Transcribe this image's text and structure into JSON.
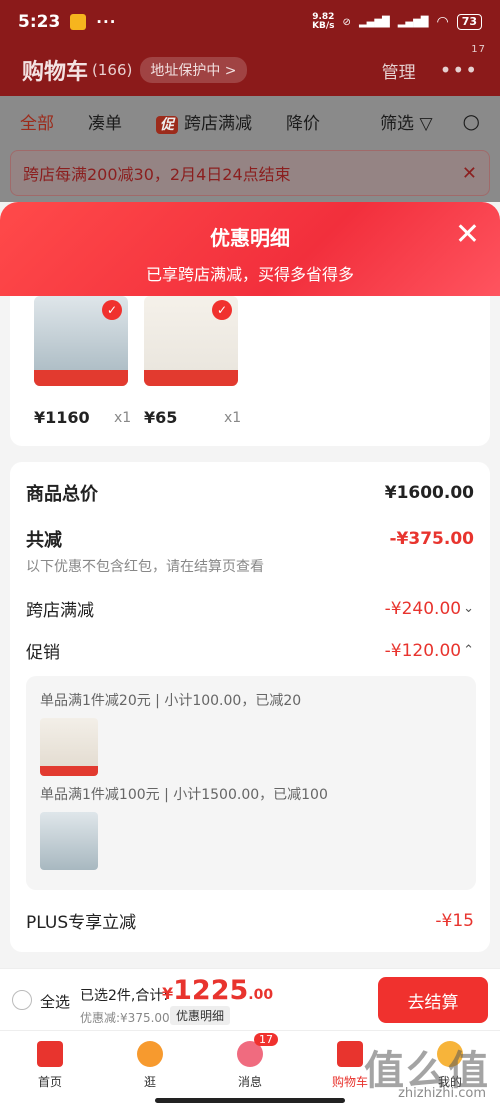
{
  "status": {
    "time": "5:23",
    "speed_top": "9.82",
    "speed_bottom": "KB/s",
    "battery": "73"
  },
  "header": {
    "title": "购物车",
    "count": "(166)",
    "address": "地址保护中 >",
    "manage": "管理",
    "more_badge": "17"
  },
  "tabs": [
    "全部",
    "凑单",
    "跨店满减",
    "降价",
    "筛选"
  ],
  "promo_tag": "促",
  "promo_bar": {
    "text": "跨店每满200减30，2月4日24点结束"
  },
  "sheet": {
    "title": "优惠明细",
    "subtitle": "已享跨店满减，买得多省得多"
  },
  "products": [
    {
      "price": "¥1160",
      "qty": "x1"
    },
    {
      "price": "¥65",
      "qty": "x1"
    }
  ],
  "summary": {
    "total_label": "商品总价",
    "total_value": "¥1600.00",
    "reduce_label": "共减",
    "reduce_value": "-¥375.00",
    "note": "以下优惠不包含红包，请在结算页查看",
    "cross_label": "跨店满减",
    "cross_value": "-¥240.00",
    "promo_label": "促销",
    "promo_value": "-¥120.00",
    "promo_line1": "单品满1件减20元 | 小计100.00，已减20",
    "promo_line2": "单品满1件减100元 | 小计1500.00，已减100",
    "plus_label": "PLUS专享立减",
    "plus_value": "-¥15"
  },
  "bottom": {
    "select_all": "全选",
    "selected": "已选2件,合计:",
    "currency": "¥",
    "total_int": "1225",
    "total_dec": ".00",
    "discount": "优惠减:¥375.00",
    "detail": "优惠明细",
    "checkout": "去结算"
  },
  "tabbar": [
    {
      "label": "首页",
      "icon": "home-icon"
    },
    {
      "label": "逛",
      "icon": "browse-icon"
    },
    {
      "label": "消息",
      "icon": "message-icon",
      "badge": "17"
    },
    {
      "label": "购物车",
      "icon": "cart-icon"
    },
    {
      "label": "我的",
      "icon": "profile-icon"
    }
  ],
  "watermark": {
    "text": "值么值",
    "url": "zhizhizhi.com"
  }
}
